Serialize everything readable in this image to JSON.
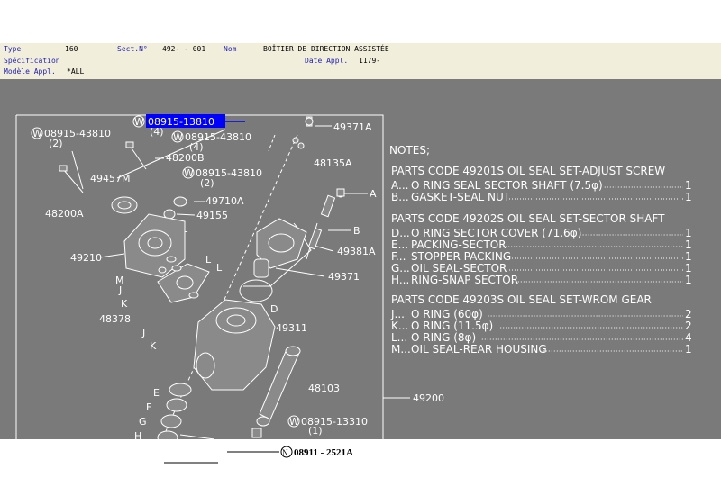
{
  "header": {
    "type_label": "Type",
    "type_value": "160",
    "sect_label": "Sect.N°",
    "sect_value": "492-  - 001",
    "nom_label": "Nom",
    "nom_value": "BOÎTIER DE DIRECTION ASSISTÉE",
    "spec_label": "Spécification",
    "date_label": "Date Appl.",
    "date_value": "1179-",
    "modele_label": "Modèle Appl.",
    "modele_value": "*ALL"
  },
  "diagram": {
    "callouts": {
      "c_08915_13810_top": "08915-13810",
      "c_08915_13810_top_qty": "(4)",
      "c_08915_43810_a": "08915-43810",
      "c_08915_43810_a_qty": "(2)",
      "c_08915_43810_b": "08915-43810",
      "c_08915_43810_b_qty": "(4)",
      "c_48200B": "48200B",
      "c_08915_43810_c": "08915-43810",
      "c_08915_43810_c_qty": "(2)",
      "c_49457M": "49457M",
      "c_49710A": "49710A",
      "c_49155": "49155",
      "c_48200A": "48200A",
      "c_49210": "49210",
      "c_49371A": "49371A",
      "c_48135A": "48135A",
      "c_A": "A",
      "c_B": "B",
      "c_49381A": "49381A",
      "c_49371": "49371",
      "c_D": "D",
      "c_49311": "49311",
      "c_48378": "48378",
      "c_M": "M",
      "c_J1": "J",
      "c_K1": "K",
      "c_L1": "L",
      "c_L2": "L",
      "c_L3": "L",
      "c_J2": "J",
      "c_K2": "K",
      "c_48103": "48103",
      "c_E": "E",
      "c_F": "F",
      "c_G": "G",
      "c_H": "H",
      "c_49200": "49200",
      "c_08915_13310": "08915-13310",
      "c_08915_13310_qty": "(1)",
      "c_08911_2521A": "08911 - 2521A",
      "circle_w": "W",
      "circle_n": "N"
    },
    "notes": {
      "title": "NOTES;",
      "group1_title": "PARTS CODE  49201S OIL SEAL SET-ADJUST SCREW",
      "group1_items": [
        {
          "letter": "A...",
          "desc": "O RING SEAL SECTOR SHAFT (7.5φ)",
          "qty": "1"
        },
        {
          "letter": "B...",
          "desc": "GASKET-SEAL NUT",
          "qty": "1"
        }
      ],
      "group2_title": "PARTS CODE  49202S OIL SEAL SET-SECTOR SHAFT",
      "group2_items": [
        {
          "letter": "D...",
          "desc": "O RING SECTOR COVER (71.6φ)",
          "qty": "1"
        },
        {
          "letter": "E...",
          "desc": "PACKING-SECTOR",
          "qty": "1"
        },
        {
          "letter": "F...",
          "desc": "STOPPER-PACKING",
          "qty": "1"
        },
        {
          "letter": "G...",
          "desc": "OIL SEAL-SECTOR",
          "qty": "1"
        },
        {
          "letter": "H...",
          "desc": "RING-SNAP SECTOR",
          "qty": "1"
        }
      ],
      "group3_title": "PARTS CODE  49203S OIL SEAL SET-WROM GEAR",
      "group3_items": [
        {
          "letter": "J...",
          "desc": "O RING (60φ)",
          "qty": "2"
        },
        {
          "letter": "K...",
          "desc": "O RING (11.5φ)",
          "qty": "2"
        },
        {
          "letter": "L...",
          "desc": "O RING (8φ)",
          "qty": "4"
        },
        {
          "letter": "M...",
          "desc": "OIL SEAL-REAR HOUSING",
          "qty": "1"
        }
      ]
    },
    "colors": {
      "background": "#7a7a7a",
      "header": "#f2eedc",
      "label_blue": "#1e1eb0",
      "highlight": "#0000ff"
    }
  }
}
